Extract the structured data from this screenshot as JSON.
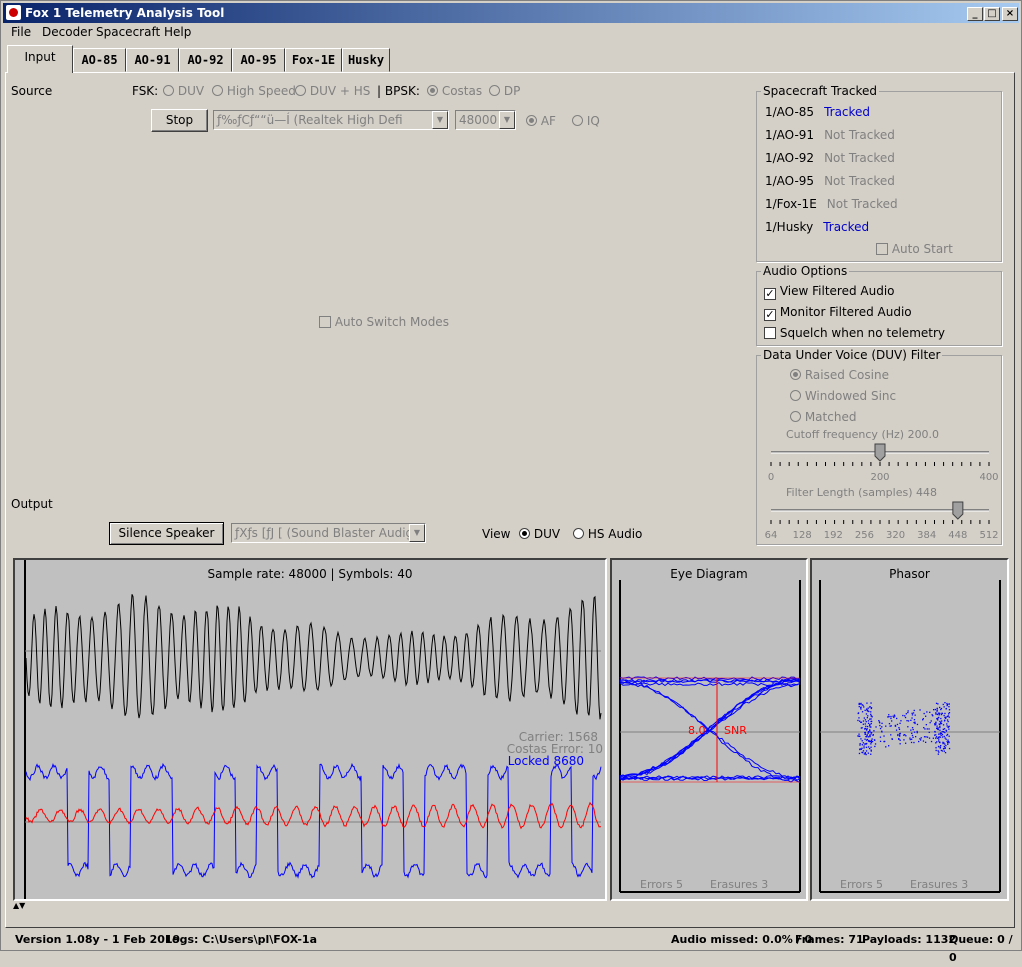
{
  "window": {
    "title": "Fox 1 Telemetry Analysis Tool"
  },
  "menu": [
    "File",
    "Decoder",
    "Spacecraft",
    "Help"
  ],
  "tabs": [
    "Input",
    "AO-85",
    "AO-91",
    "AO-92",
    "AO-95",
    "Fox-1E",
    "Husky"
  ],
  "source": {
    "label": "Source",
    "fsk_label": "FSK:",
    "fsk_options": [
      "DUV",
      "High Speed",
      "DUV + HS"
    ],
    "bpsk_label": "| BPSK:",
    "bpsk_options": [
      "Costas",
      "DP"
    ],
    "stop_label": "Stop",
    "device": "ƒ‰ƒCƒ““ü—Í (Realtek High Defi",
    "rate": "48000",
    "mode_options": [
      "AF",
      "IQ"
    ],
    "auto_switch": "Auto Switch Modes"
  },
  "output": {
    "label": "Output",
    "silence_label": "Silence Speaker",
    "device": "ƒXƒs [ƒJ [ (Sound Blaster Audig",
    "view_label": "View",
    "view_options": [
      "DUV",
      "HS Audio"
    ]
  },
  "spacecraft": {
    "title": "Spacecraft Tracked",
    "items": [
      {
        "name": "1/AO-85",
        "status": "Tracked"
      },
      {
        "name": "1/AO-91",
        "status": "Not Tracked"
      },
      {
        "name": "1/AO-92",
        "status": "Not Tracked"
      },
      {
        "name": "1/AO-95",
        "status": "Not Tracked"
      },
      {
        "name": "1/Fox-1E",
        "status": "Not Tracked"
      },
      {
        "name": "1/Husky",
        "status": "Tracked"
      }
    ],
    "auto_start": "Auto Start"
  },
  "audio": {
    "title": "Audio Options",
    "options": [
      "View Filtered Audio",
      "Monitor Filtered Audio",
      "Squelch when no telemetry"
    ],
    "checked": [
      true,
      true,
      false
    ]
  },
  "filter": {
    "title": "Data Under Voice (DUV) Filter",
    "options": [
      "Raised Cosine",
      "Windowed Sinc",
      "Matched"
    ],
    "cutoff_label": "Cutoff frequency (Hz) 200.0",
    "cutoff_ticks": [
      "0",
      "200",
      "400"
    ],
    "cutoff_value": 200,
    "length_label": "Filter Length (samples) 448",
    "length_ticks": [
      "64",
      "128",
      "192",
      "256",
      "320",
      "384",
      "448",
      "512"
    ],
    "length_value": 448
  },
  "scope": {
    "header": "Sample rate: 48000 | Symbols: 40",
    "carrier": "Carrier: 1568",
    "costas": "Costas Error: 10",
    "locked": "Locked 8680"
  },
  "eye": {
    "title": "Eye Diagram",
    "value": "8.0",
    "snr": "SNR",
    "errors": "Errors  5",
    "erasures": "Erasures  3"
  },
  "phasor": {
    "title": "Phasor",
    "errors": "Errors  5",
    "erasures": "Erasures  3"
  },
  "status": {
    "version": "Version 1.08y - 1 Feb 2019",
    "logs": "Logs: C:\\Users\\pl\\FOX-1a",
    "audio_missed": "Audio missed: 0.0% / 0",
    "frames": "Frames: 71",
    "payloads": "Payloads: 1132",
    "queue": "Queue: 0 / 0"
  },
  "colors": {
    "tracked": "#0000cc",
    "trace_black": "#000000",
    "trace_blue": "#0000ff",
    "trace_red": "#ff0000",
    "scope_bg": "#c0c0c0"
  }
}
